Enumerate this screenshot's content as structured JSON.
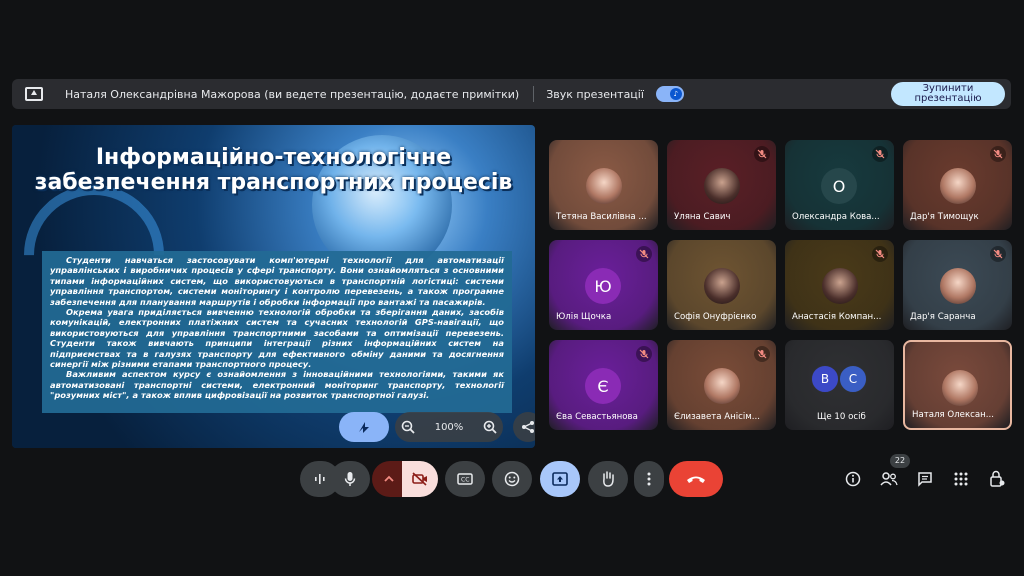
{
  "banner": {
    "presenter_text": "Наталя Олександрівна Мажорова (ви ведете презентацію, додаєте примітки)",
    "audio_label": "Звук презентації",
    "stop_button": "Зупинити презентацію"
  },
  "slide": {
    "title_line1": "Інформаційно-технологічне",
    "title_line2": "забезпечення транспортних процесів",
    "paragraphs": [
      "Студенти навчаться застосовувати комп'ютерні технології для автоматизації управлінських і виробничих процесів у сфері транспорту. Вони ознайомляться з основними типами інформаційних систем, що використовуються в транспортній логістиці: системи управління транспортом, системи моніторингу і контролю перевезень, а також програмне забезпечення для планування маршрутів і обробки інформації про вантажі та пасажирів.",
      "Окрема увага приділяється вивченню технологій обробки та зберігання даних, засобів комунікацій, електронних платіжних систем та сучасних технологій GPS-навігації, що використовуються для управління транспортними засобами та оптимізації перевезень. Студенти також вивчають принципи інтеграції різних інформаційних систем на підприємствах та в галузях транспорту для ефективного обміну даними та досягнення синергії між різними етапами транспортного процесу.",
      "Важливим аспектом курсу є ознайомлення з інноваційними технологіями, такими як автоматизовані транспортні системи, електронний моніторинг транспорту, технології \"розумних міст\", а також вплив цифровізації на розвиток транспортної галузі."
    ],
    "zoom_level": "100%"
  },
  "participants": [
    {
      "name": "Тетяна Василівна ...",
      "type": "photo",
      "muted": false,
      "bg": "#8a5a45"
    },
    {
      "name": "Уляна Савич",
      "type": "photo-dark",
      "muted": true,
      "bg": "#5a1f26"
    },
    {
      "name": "Олександра Кова...",
      "type": "letter",
      "letter": "О",
      "muted": true,
      "bg": "#173a3e",
      "avatar_bg": "#26474b"
    },
    {
      "name": "Дар'я Тимощук",
      "type": "photo",
      "muted": true,
      "bg": "#6a3b2e"
    },
    {
      "name": "Юлія Щочка",
      "type": "letter",
      "letter": "Ю",
      "muted": true,
      "bg": "#6a1f9a",
      "avatar_bg": "#8a2bb5"
    },
    {
      "name": "Софія Онуфрієнко",
      "type": "photo-dark",
      "muted": false,
      "bg": "#6e5432"
    },
    {
      "name": "Анастасія Компан...",
      "type": "photo-dark",
      "muted": true,
      "bg": "#4a3a18"
    },
    {
      "name": "Дар'я Саранча",
      "type": "photo",
      "muted": true,
      "bg": "#3c4a55"
    },
    {
      "name": "Єва Севастьянова",
      "type": "letter",
      "letter": "Є",
      "muted": true,
      "bg": "#6a1f9a",
      "avatar_bg": "#8a2bb5"
    },
    {
      "name": "Єлизавета Анісім...",
      "type": "photo",
      "muted": true,
      "bg": "#7a4c38"
    },
    {
      "name": "Ще 10 осіб",
      "type": "more",
      "letters": [
        "В",
        "С"
      ],
      "muted": false,
      "bg": "#2f3033"
    },
    {
      "name": "Наталя Олексан...",
      "type": "photo",
      "muted": false,
      "bg": "#7a4a3c",
      "selected": true
    }
  ],
  "people_count": "22",
  "colors": {
    "end_call": "#ea4335",
    "present_active": "#a8c7fa",
    "camera_off": "#f9dedc"
  },
  "icons": {
    "stop_present": "present-to-all-icon",
    "audio_toggle": "volume-icon"
  }
}
